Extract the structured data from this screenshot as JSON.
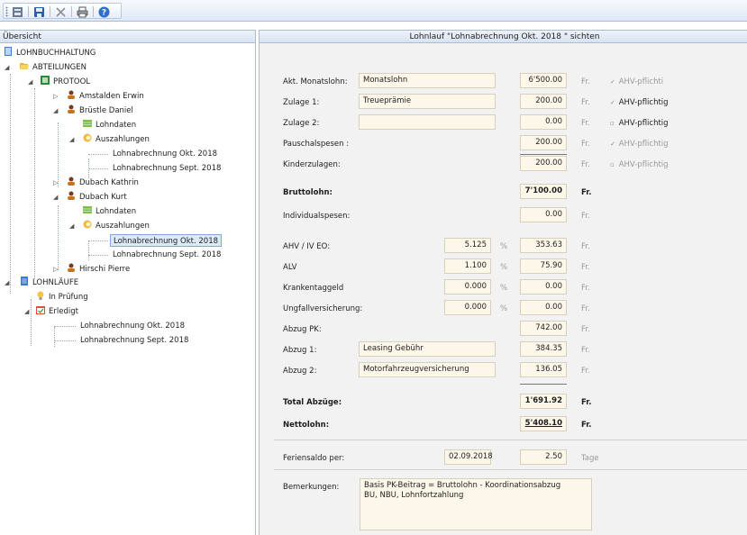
{
  "toolbar": {
    "buttons": [
      "layout-icon",
      "save-icon",
      "delete-icon",
      "print-icon",
      "help-icon"
    ]
  },
  "left": {
    "header": "Übersicht",
    "tree": {
      "root": "LOHNBUCHHALTUNG",
      "abteilungen": "ABTEILUNGEN",
      "protool": "PROTOOL",
      "amstalden": "Amstalden Erwin",
      "bruestle": "Brüstle Daniel",
      "lohndaten1": "Lohndaten",
      "auszahlungen1": "Auszahlungen",
      "okt1": "Lohnabrechnung Okt. 2018",
      "sept1": "Lohnabrechnung Sept. 2018",
      "dubach_k": "Dubach Kathrin",
      "dubach_kurt": "Dubach Kurt",
      "lohndaten2": "Lohndaten",
      "auszahlungen2": "Auszahlungen",
      "okt2": "Lohnabrechnung Okt. 2018",
      "sept2": "Lohnabrechnung Sept. 2018",
      "hirschi": "Hirschi Pierre",
      "lohnlaeufe": "LOHNLÄUFE",
      "pruefung": "In Prüfung",
      "erledigt": "Erledigt",
      "okt3": "Lohnabrechnung Okt. 2018",
      "sept3": "Lohnabrechnung Sept. 2018"
    }
  },
  "right": {
    "header": "Lohnlauf \"Lohnabrechnung Okt. 2018 \" sichten",
    "rows": {
      "monatslohn": {
        "label": "Akt. Monatslohn:",
        "text": "Monatslohn",
        "amount": "6'500.00",
        "unit": "Fr.",
        "check": "AHV-pflichti"
      },
      "zulage1": {
        "label": "Zulage 1:",
        "text": "Treueprämie",
        "amount": "200.00",
        "unit": "Fr.",
        "check": "AHV-pflichtig"
      },
      "zulage2": {
        "label": "Zulage 2:",
        "text": "",
        "amount": "0.00",
        "unit": "Fr.",
        "check": "AHV-pflichtig"
      },
      "pauschal": {
        "label": "Pauschalspesen :",
        "amount": "200.00",
        "unit": "Fr.",
        "check": "AHV-pflichtig"
      },
      "kinder": {
        "label": "Kinderzulagen:",
        "amount": "200.00",
        "unit": "Fr.",
        "check": "AHV-pflichtig"
      },
      "brutto": {
        "label": "Bruttolohn:",
        "amount": "7'100.00",
        "unit": "Fr."
      },
      "indiv": {
        "label": "Individualspesen:",
        "amount": "0.00",
        "unit": "Fr."
      },
      "ahv": {
        "label": "AHV / IV EO:",
        "rate": "5.125",
        "pct": "%",
        "amount": "353.63",
        "unit": "Fr."
      },
      "alv": {
        "label": "ALV",
        "rate": "1.100",
        "pct": "%",
        "amount": "75.90",
        "unit": "Fr."
      },
      "krank": {
        "label": "Krankentaggeld",
        "rate": "0.000",
        "pct": "%",
        "amount": "0.00",
        "unit": "Fr."
      },
      "unfall": {
        "label": "Ungfallversicherung:",
        "rate": "0.000",
        "pct": "%",
        "amount": "0.00",
        "unit": "Fr."
      },
      "pk": {
        "label": "Abzug PK:",
        "amount": "742.00",
        "unit": "Fr."
      },
      "abzug1": {
        "label": "Abzug 1:",
        "text": "Leasing Gebühr",
        "amount": "384.35",
        "unit": "Fr."
      },
      "abzug2": {
        "label": "Abzug 2:",
        "text": "Motorfahrzeugversicherung",
        "amount": "136.05",
        "unit": "Fr."
      },
      "total": {
        "label": "Total Abzüge:",
        "amount": "1'691.92",
        "unit": "Fr."
      },
      "netto": {
        "label": "Nettolohn:",
        "amount": "5'408.10",
        "unit": "Fr."
      },
      "ferien": {
        "label": "Feriensaldo per:",
        "date": "02.09.2018",
        "amount": "2.50",
        "unit": "Tage"
      }
    },
    "remarks": {
      "label": "Bemerkungen:",
      "line1": "Basis PK-Beitrag = Bruttolohn - Koordinationsabzug",
      "line2": "BU, NBU, Lohnfortzahlung"
    }
  }
}
